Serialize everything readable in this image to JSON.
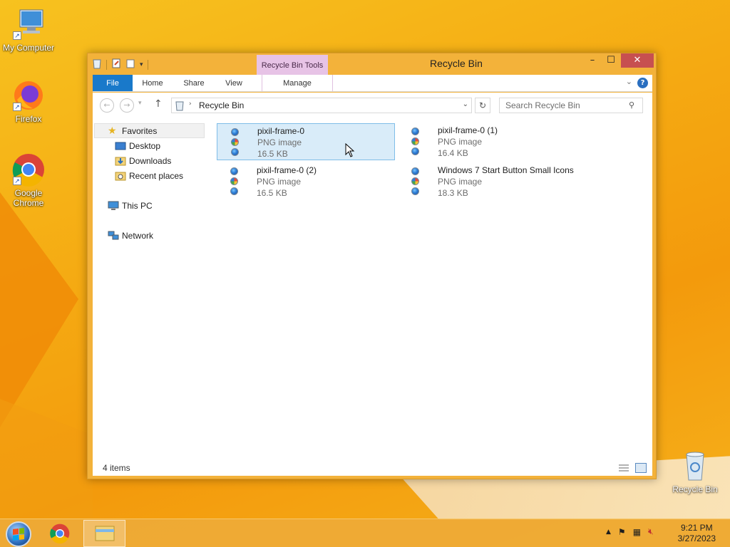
{
  "desktop": {
    "icons": [
      {
        "label": "My Computer",
        "icon": "computer-icon"
      },
      {
        "label": "Firefox",
        "icon": "firefox-icon"
      },
      {
        "label": "Google Chrome",
        "icon": "chrome-icon"
      },
      {
        "label": "Recycle Bin",
        "icon": "recycle-bin-icon"
      }
    ]
  },
  "window": {
    "title": "Recycle Bin",
    "context_tab_group": "Recycle Bin Tools",
    "controls": {
      "minimize": "–",
      "maximize": "☐",
      "close": "✕"
    },
    "ribbon_tabs": [
      "File",
      "Home",
      "Share",
      "View",
      "Manage"
    ],
    "address": "Recycle Bin",
    "search_placeholder": "Search Recycle Bin",
    "nav": {
      "favorites": "Favorites",
      "favorites_items": [
        "Desktop",
        "Downloads",
        "Recent places"
      ],
      "this_pc": "This PC",
      "network": "Network"
    },
    "files": [
      {
        "name": "pixil-frame-0",
        "type": "PNG image",
        "size": "16.5 KB",
        "selected": true
      },
      {
        "name": "pixil-frame-0 (1)",
        "type": "PNG image",
        "size": "16.4 KB",
        "selected": false
      },
      {
        "name": "pixil-frame-0 (2)",
        "type": "PNG image",
        "size": "16.5 KB",
        "selected": false
      },
      {
        "name": "Windows 7 Start Button Small Icons",
        "type": "PNG image",
        "size": "18.3 KB",
        "selected": false
      }
    ],
    "status": "4 items"
  },
  "taskbar": {
    "clock_time": "9:21 PM",
    "clock_date": "3/27/2023"
  },
  "colors": {
    "file_tab": "#1979ca",
    "context_tools": "#e7c3e6",
    "close_button": "#c75050",
    "selection": "#d9ecf9"
  }
}
